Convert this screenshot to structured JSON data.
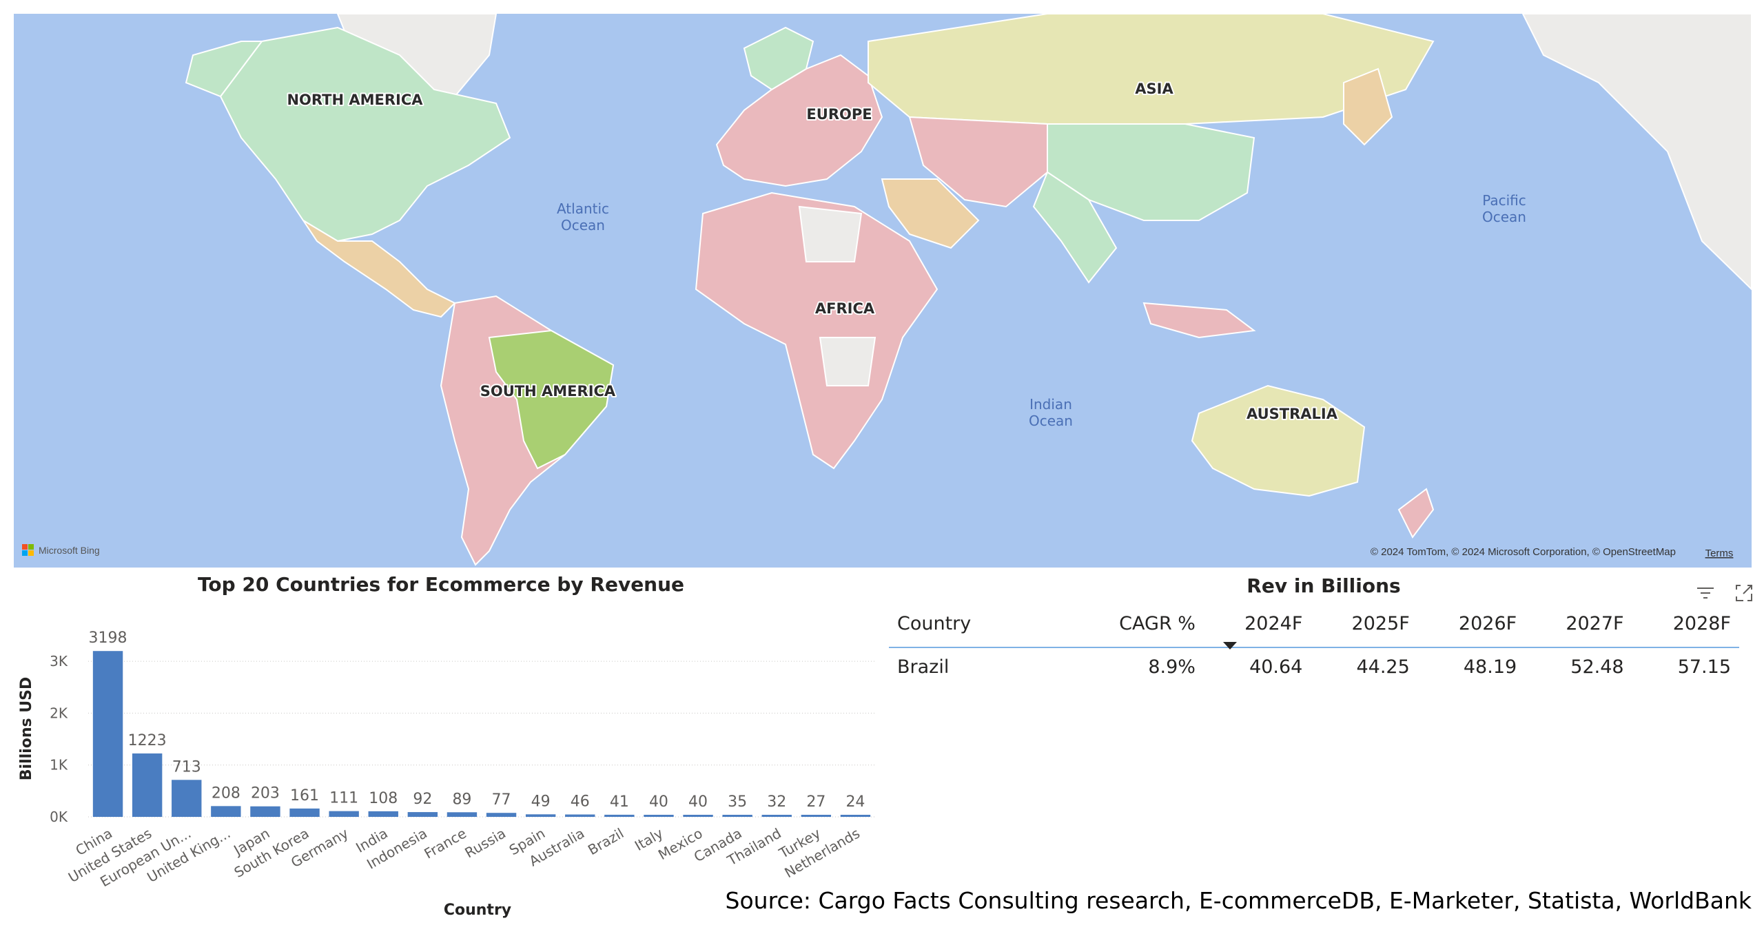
{
  "map": {
    "continents": [
      "NORTH AMERICA",
      "EUROPE",
      "ASIA",
      "AFRICA",
      "SOUTH AMERICA",
      "AUSTRALIA"
    ],
    "oceans": {
      "atlantic": [
        "Atlantic",
        "Ocean"
      ],
      "pacific": [
        "Pacific",
        "Ocean"
      ],
      "indian": [
        "Indian",
        "Ocean"
      ]
    },
    "attribution": "© 2024 TomTom, © 2024 Microsoft Corporation, © OpenStreetMap",
    "terms": "Terms",
    "brand": "Microsoft Bing",
    "colors": {
      "ocean": "#a9c6ef",
      "land_green": "#bfe5c7",
      "land_pink": "#eab9bd",
      "land_yellow": "#e6e6b4",
      "land_orange": "#ecd1a6",
      "land_grey": "#ecebe9",
      "highlight": "#a9cf72"
    }
  },
  "chart": {
    "title": "Top 20 Countries for Ecommerce by Revenue",
    "bar_color": "#4a7dc1"
  },
  "chart_data": {
    "type": "bar",
    "title": "Top 20 Countries for Ecommerce by Revenue",
    "xlabel": "Country",
    "ylabel": "Billions USD",
    "categories": [
      "China",
      "United States",
      "European Un...",
      "United King...",
      "Japan",
      "South Korea",
      "Germany",
      "India",
      "Indonesia",
      "France",
      "Russia",
      "Spain",
      "Australia",
      "Brazil",
      "Italy",
      "Mexico",
      "Canada",
      "Thailand",
      "Turkey",
      "Netherlands"
    ],
    "values": [
      3198,
      1223,
      713,
      208,
      203,
      161,
      111,
      108,
      92,
      89,
      77,
      49,
      46,
      41,
      40,
      40,
      35,
      32,
      27,
      24
    ],
    "ylim": [
      0,
      3400
    ],
    "yticks": [
      0,
      1000,
      2000,
      3000
    ],
    "ytick_labels": [
      "0K",
      "1K",
      "2K",
      "3K"
    ],
    "grid": true,
    "legend": "none"
  },
  "table": {
    "title": "Rev in Billions",
    "columns": [
      "Country",
      "CAGR %",
      "2024F",
      "2025F",
      "2026F",
      "2027F",
      "2028F"
    ],
    "rows": [
      {
        "country": "Brazil",
        "cagr": "8.9%",
        "y2024": "40.64",
        "y2025": "44.25",
        "y2026": "48.19",
        "y2027": "52.48",
        "y2028": "57.15"
      }
    ],
    "header_rule_color": "#7fb2e5"
  },
  "source": "Source: Cargo Facts Consulting research, E-commerceDB, E-Marketer, Statista, WorldBank"
}
